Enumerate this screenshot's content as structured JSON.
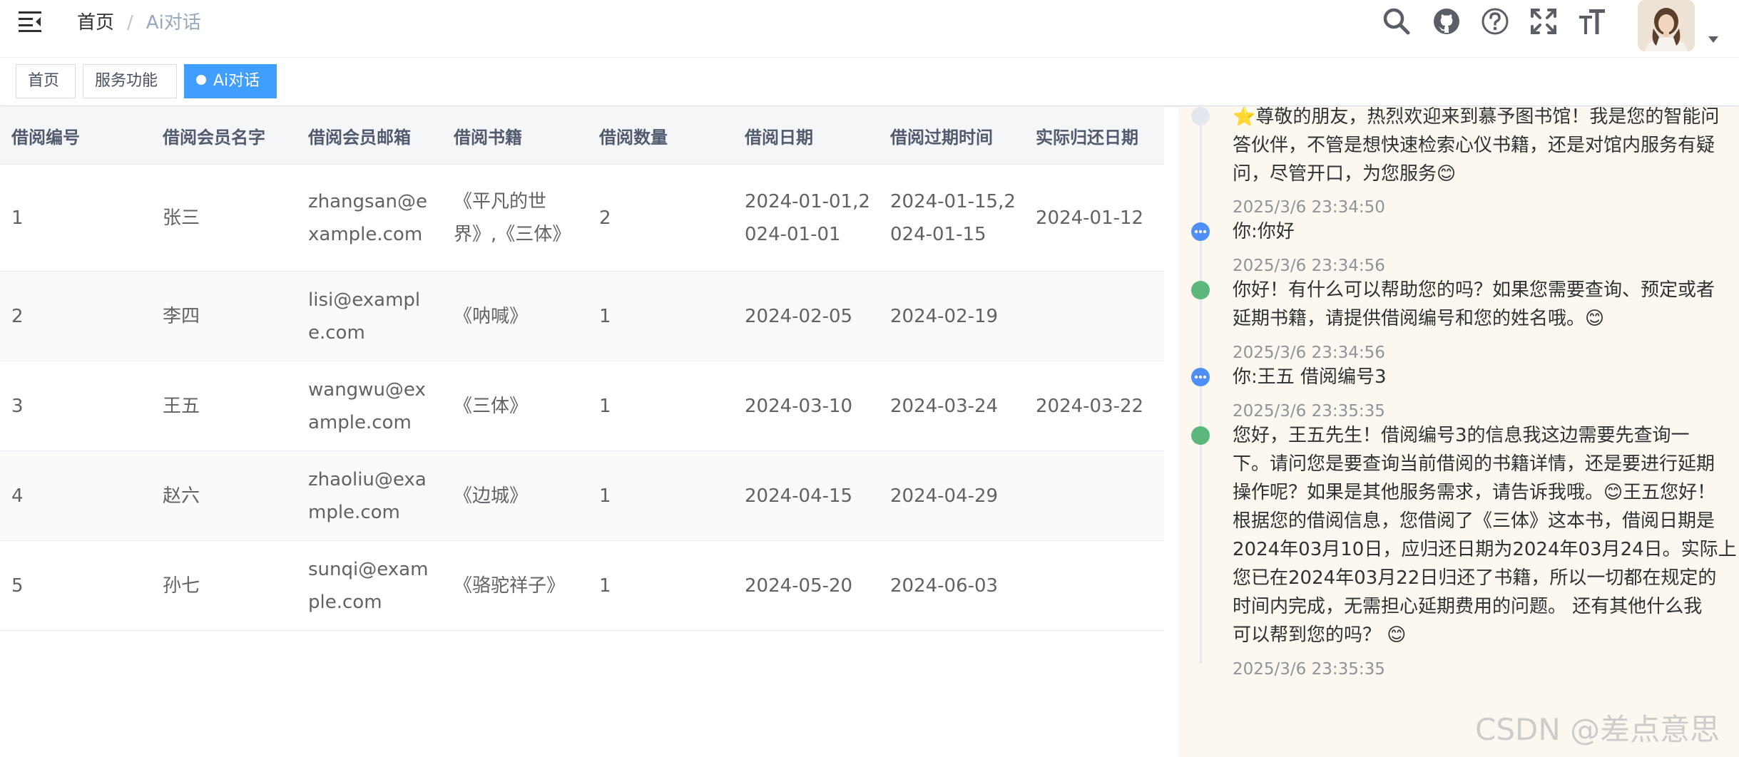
{
  "header": {
    "breadcrumb_home": "首页",
    "breadcrumb_sep": "/",
    "breadcrumb_current": "Ai对话",
    "icons": [
      "search-icon",
      "github-icon",
      "question-icon",
      "fullscreen-icon",
      "font-size-icon"
    ]
  },
  "tags": [
    {
      "label": "首页",
      "active": false
    },
    {
      "label": "服务功能",
      "active": false
    },
    {
      "label": "Ai对话",
      "active": true
    }
  ],
  "table": {
    "headers": [
      "借阅编号",
      "借阅会员名字",
      "借阅会员邮箱",
      "借阅书籍",
      "借阅数量",
      "借阅日期",
      "借阅过期时间",
      "实际归还日期"
    ],
    "rows": [
      {
        "id": "1",
        "name": "张三",
        "email": "zhangsan@example.com",
        "book": "《平凡的世界》,《三体》",
        "qty": "2",
        "date": "2024-01-01,2024-01-01",
        "due": "2024-01-15,2024-01-15",
        "returned": "2024-01-12"
      },
      {
        "id": "2",
        "name": "李四",
        "email": "lisi@example.com",
        "book": "《呐喊》",
        "qty": "1",
        "date": "2024-02-05",
        "due": "2024-02-19",
        "returned": ""
      },
      {
        "id": "3",
        "name": "王五",
        "email": "wangwu@example.com",
        "book": "《三体》",
        "qty": "1",
        "date": "2024-03-10",
        "due": "2024-03-24",
        "returned": "2024-03-22"
      },
      {
        "id": "4",
        "name": "赵六",
        "email": "zhaoliu@example.com",
        "book": "《边城》",
        "qty": "1",
        "date": "2024-04-15",
        "due": "2024-04-29",
        "returned": ""
      },
      {
        "id": "5",
        "name": "孙七",
        "email": "sunqi@example.com",
        "book": "《骆驼祥子》",
        "qty": "1",
        "date": "2024-05-20",
        "due": "2024-06-03",
        "returned": ""
      }
    ]
  },
  "chat": {
    "welcome_lines": [
      "⭐尊敬的朋友，热烈欢迎来到慕予图书馆！我是您的智能问",
      "答伙伴，不管是想快速检索心仪书籍，还是对馆内服务有疑",
      "问，尽管开口，为您服务😊"
    ],
    "ts1": "2025/3/6 23:34:50",
    "user1": "你:你好",
    "ts2": "2025/3/6 23:34:56",
    "ai1_lines": [
      "你好！有什么可以帮助您的吗？如果您需要查询、预定或者",
      "延期书籍，请提供借阅编号和您的姓名哦。😊"
    ],
    "ts3": "2025/3/6 23:34:56",
    "user2": "你:王五 借阅编号3",
    "ts4": "2025/3/6 23:35:35",
    "ai2_lines": [
      "您好，王五先生！借阅编号3的信息我这边需要先查询一",
      "下。请问您是要查询当前借阅的书籍详情，还是要进行延期",
      "操作呢？如果是其他服务需求，请告诉我哦。😊王五您好！",
      "根据您的借阅信息，您借阅了《三体》这本书，借阅日期是",
      "2024年03月10日，应归还日期为2024年03月24日。实际上",
      "您已在2024年03月22日归还了书籍，所以一切都在规定的",
      "时间内完成，无需担心延期费用的问题。 还有其他什么我",
      "可以帮到您的吗？ 😊"
    ],
    "ts5": "2025/3/6 23:35:35"
  },
  "watermark": "CSDN @差点意思"
}
